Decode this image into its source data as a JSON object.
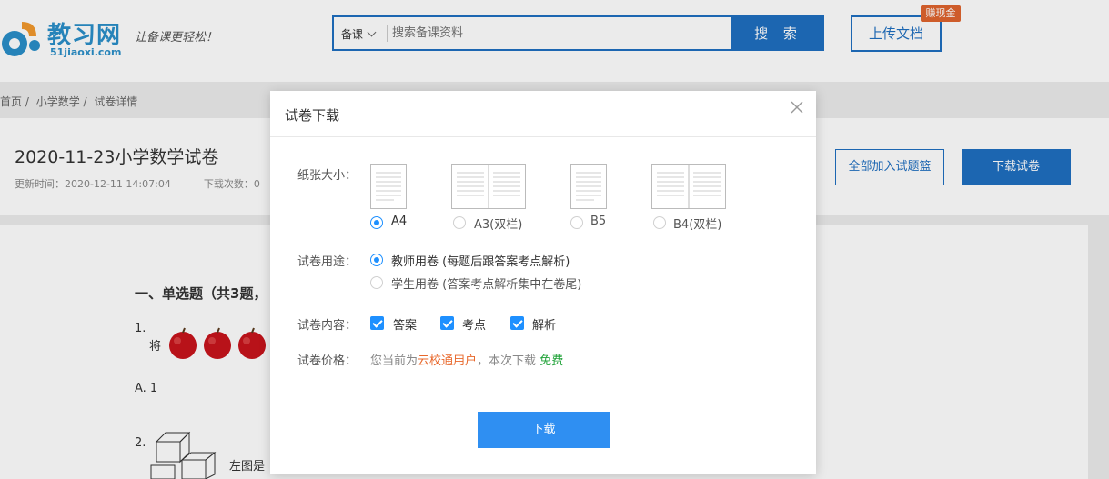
{
  "header": {
    "logo_name": "教习网",
    "logo_domain": "51jiaoxi.com",
    "slogan": "让备课更轻松！",
    "search": {
      "category": "备课",
      "placeholder": "搜索备课资料",
      "button_label": "搜 索"
    },
    "upload_label": "上传文档",
    "earn_badge": "赚现金"
  },
  "breadcrumb": [
    "首页 /",
    "小学数学 /",
    "试卷详情"
  ],
  "paper": {
    "title": "2020-11-23小学数学试卷",
    "update_time": "更新时间：2020-12-11 14:07:04",
    "download_count": "下载次数：0",
    "add_all_label": "全部加入试题篮",
    "download_label": "下载试卷",
    "section_title": "一、单选题（共3题，",
    "q1_number": "1.",
    "q1_text": "将",
    "q1_option_a": "A. 1",
    "q2_number": "2.",
    "q2_text": "左图是"
  },
  "modal": {
    "title": "试卷下载",
    "paper_size": {
      "label": "纸张大小：",
      "options": [
        {
          "label": "A4",
          "selected": true
        },
        {
          "label": "A3(双栏)",
          "selected": false
        },
        {
          "label": "B5",
          "selected": false
        },
        {
          "label": "B4(双栏)",
          "selected": false
        }
      ]
    },
    "usage": {
      "label": "试卷用途：",
      "options": [
        {
          "label": "教师用卷 (每题后跟答案考点解析)",
          "selected": true
        },
        {
          "label": "学生用卷 (答案考点解析集中在卷尾)",
          "selected": false
        }
      ]
    },
    "content": {
      "label": "试卷内容：",
      "options": [
        {
          "label": "答案",
          "checked": true
        },
        {
          "label": "考点",
          "checked": true
        },
        {
          "label": "解析",
          "checked": true
        }
      ]
    },
    "price": {
      "label": "试卷价格：",
      "prefix": "您当前为",
      "user_type": "云校通用户",
      "middle": "，本次下载",
      "price": "免费"
    },
    "download_button": "下载"
  },
  "colors": {
    "brand_blue": "#1f6fc1",
    "accent_blue": "#1e90ff",
    "vip_orange": "#e8672a",
    "free_green": "#22a33a",
    "badge_orange": "#e0642e"
  }
}
